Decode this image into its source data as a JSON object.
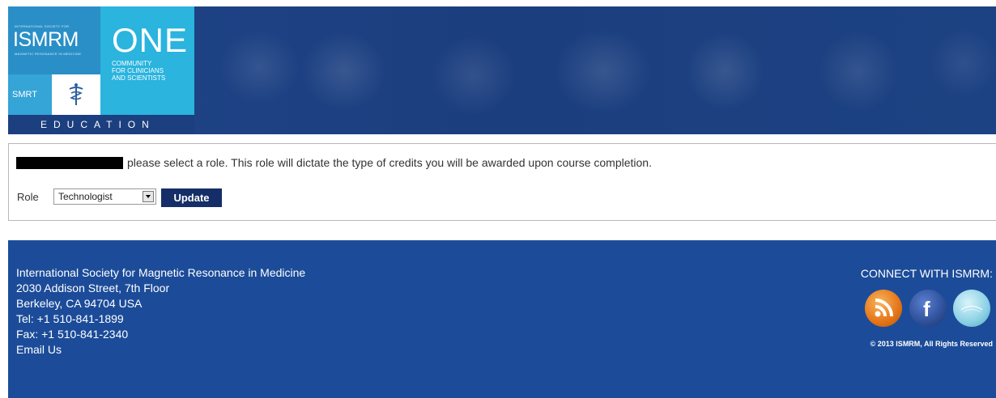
{
  "header": {
    "logo_small_top": "INTERNATIONAL SOCIETY FOR",
    "logo_name": "ISMRM",
    "logo_small_bottom": "MAGNETIC RESONANCE IN MEDICINE",
    "logo_smrt": "SMRT",
    "logo_one": "ONE",
    "logo_community": [
      "COMMUNITY",
      "FOR CLINICIANS",
      "AND SCIENTISTS"
    ],
    "education": "EDUCATION"
  },
  "role_form": {
    "instruction": "please select a role. This role will dictate the type of credits you will be awarded upon course completion.",
    "role_label": "Role",
    "role_selected": "Technologist",
    "update_label": "Update"
  },
  "footer": {
    "address": [
      "International Society for Magnetic Resonance in Medicine",
      "2030 Addison Street, 7th Floor",
      "Berkeley, CA 94704 USA",
      "Tel: +1 510-841-1899",
      "Fax: +1 510-841-2340",
      "Email Us"
    ],
    "connect": "CONNECT WITH ISMRM:",
    "social_icons": [
      "rss-icon",
      "facebook-icon",
      "social-network-icon"
    ],
    "copyright": "© 2013 ISMRM, All Rights Reserved"
  },
  "colors": {
    "banner": "#1c3f7f",
    "footer": "#1c4c99",
    "update_button": "#152e67",
    "logo_cyan": "#2ab4de"
  }
}
